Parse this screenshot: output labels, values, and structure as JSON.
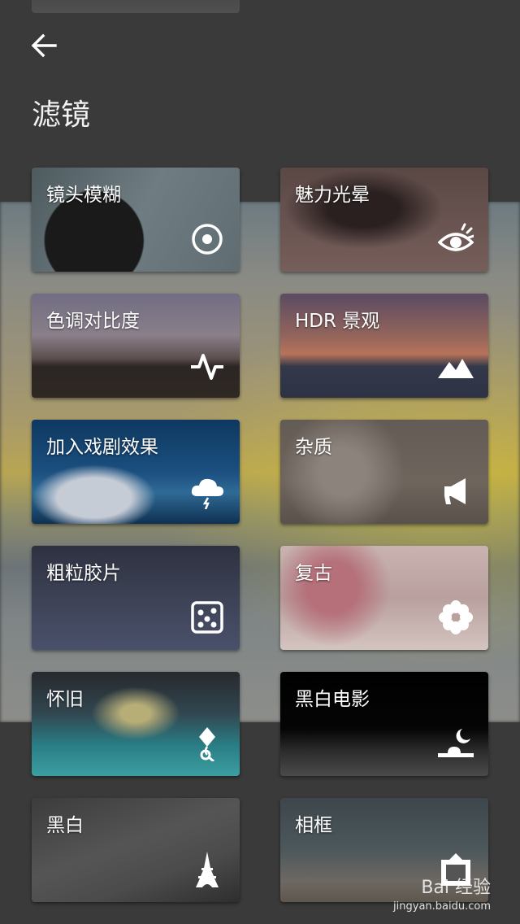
{
  "header": {
    "title": "滤镜",
    "back_icon": "arrow-left-icon"
  },
  "filters": [
    {
      "label": "镜头模糊",
      "icon": "target-icon"
    },
    {
      "label": "魅力光晕",
      "icon": "eye-icon"
    },
    {
      "label": "色调对比度",
      "icon": "pulse-icon"
    },
    {
      "label": "HDR 景观",
      "icon": "mountains-icon"
    },
    {
      "label": "加入戏剧效果",
      "icon": "storm-cloud-icon"
    },
    {
      "label": "杂质",
      "icon": "megaphone-icon"
    },
    {
      "label": "粗粒胶片",
      "icon": "dice-icon"
    },
    {
      "label": "复古",
      "icon": "flower-icon"
    },
    {
      "label": "怀旧",
      "icon": "kite-icon"
    },
    {
      "label": "黑白电影",
      "icon": "moon-icon"
    },
    {
      "label": "黑白",
      "icon": "eiffel-tower-icon"
    },
    {
      "label": "相框",
      "icon": "frame-icon"
    }
  ],
  "watermark": {
    "brand": "Bai 经验",
    "url": "jingyan.baidu.com"
  }
}
